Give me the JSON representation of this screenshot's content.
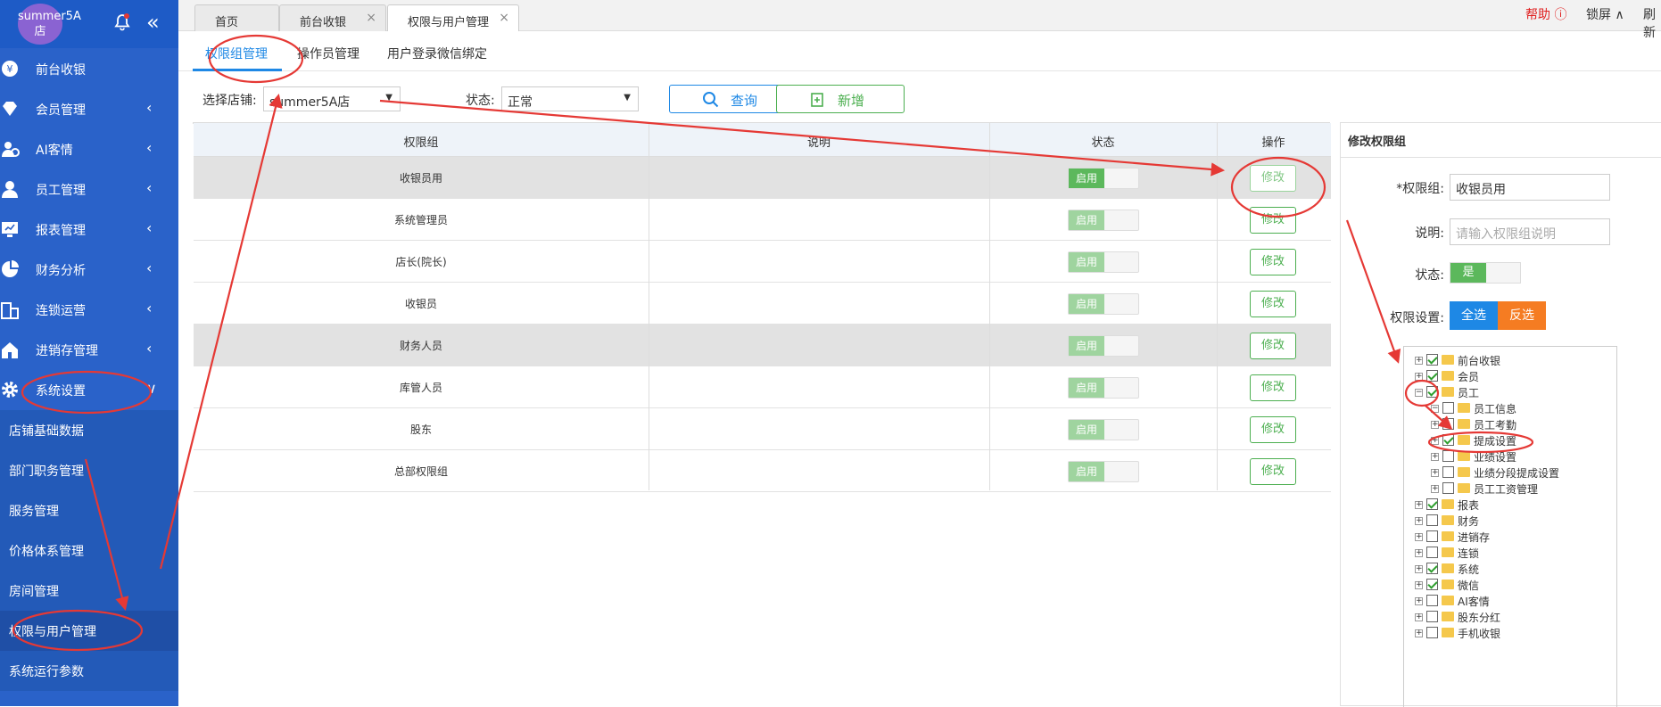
{
  "sidebar": {
    "logo": "summer5A店",
    "menu": [
      {
        "label": "前台收银",
        "icon": "cashier-icon"
      },
      {
        "label": "会员管理",
        "icon": "diamond-icon"
      },
      {
        "label": "AI客情",
        "icon": "ai-customer-icon"
      },
      {
        "label": "员工管理",
        "icon": "user-icon"
      },
      {
        "label": "报表管理",
        "icon": "report-icon"
      },
      {
        "label": "财务分析",
        "icon": "pie-chart-icon"
      },
      {
        "label": "连锁运营",
        "icon": "building-icon"
      },
      {
        "label": "进销存管理",
        "icon": "house-icon"
      },
      {
        "label": "系统设置",
        "icon": "gear-icon"
      }
    ],
    "submenu": [
      "店铺基础数据",
      "部门职务管理",
      "服务管理",
      "价格体系管理",
      "房间管理",
      "权限与用户管理",
      "系统运行参数"
    ]
  },
  "tabs": [
    {
      "label": "首页"
    },
    {
      "label": "前台收银"
    },
    {
      "label": "权限与用户管理"
    }
  ],
  "header": {
    "help": "帮助",
    "lock": "锁屏",
    "refresh": "刷新"
  },
  "subtabs": [
    "权限组管理",
    "操作员管理",
    "用户登录微信绑定"
  ],
  "filters": {
    "store_label": "选择店铺:",
    "store_value": "summer5A店",
    "status_label": "状态:",
    "status_value": "正常",
    "query_label": "查询",
    "add_label": "新增"
  },
  "table": {
    "columns": [
      "权限组",
      "说明",
      "状态",
      "操作"
    ],
    "status_on_label": "启用",
    "edit_label": "修改",
    "rows": [
      {
        "name": "收银员用",
        "desc": ""
      },
      {
        "name": "系统管理员",
        "desc": ""
      },
      {
        "name": "店长(院长)",
        "desc": ""
      },
      {
        "name": "收银员",
        "desc": ""
      },
      {
        "name": "财务人员",
        "desc": ""
      },
      {
        "name": "库管人员",
        "desc": ""
      },
      {
        "name": "股东",
        "desc": ""
      },
      {
        "name": "总部权限组",
        "desc": ""
      }
    ]
  },
  "panel": {
    "title": "修改权限组",
    "group_label": "*权限组:",
    "group_value": "收银员用",
    "desc_label": "说明:",
    "desc_placeholder": "请输入权限组说明",
    "status_label": "状态:",
    "status_value": "是",
    "perm_label": "权限设置:",
    "select_all": "全选",
    "invert": "反选",
    "tree": [
      {
        "label": "前台收银",
        "checked": true,
        "level": 0,
        "expanded": false
      },
      {
        "label": "会员",
        "checked": true,
        "level": 0,
        "expanded": false
      },
      {
        "label": "员工",
        "checked": true,
        "level": 0,
        "expanded": true
      },
      {
        "label": "员工信息",
        "checked": false,
        "level": 1,
        "expanded": true
      },
      {
        "label": "员工考勤",
        "checked": false,
        "level": 1,
        "expanded": false
      },
      {
        "label": "提成设置",
        "checked": true,
        "level": 1,
        "expanded": false
      },
      {
        "label": "业绩设置",
        "checked": false,
        "level": 1,
        "expanded": false
      },
      {
        "label": "业绩分段提成设置",
        "checked": false,
        "level": 1,
        "expanded": false
      },
      {
        "label": "员工工资管理",
        "checked": false,
        "level": 1,
        "expanded": false
      },
      {
        "label": "报表",
        "checked": true,
        "level": 0,
        "expanded": false
      },
      {
        "label": "财务",
        "checked": false,
        "level": 0,
        "expanded": false
      },
      {
        "label": "进销存",
        "checked": false,
        "level": 0,
        "expanded": false
      },
      {
        "label": "连锁",
        "checked": false,
        "level": 0,
        "expanded": false
      },
      {
        "label": "系统",
        "checked": true,
        "level": 0,
        "expanded": false
      },
      {
        "label": "微信",
        "checked": true,
        "level": 0,
        "expanded": false
      },
      {
        "label": "AI客情",
        "checked": false,
        "level": 0,
        "expanded": false
      },
      {
        "label": "股东分红",
        "checked": false,
        "level": 0,
        "expanded": false
      },
      {
        "label": "手机收银",
        "checked": false,
        "level": 0,
        "expanded": false
      }
    ]
  },
  "colors": {
    "sidebar": "#2a62c9",
    "accent": "#1e88e5",
    "green": "#4caf50",
    "orange": "#f57c22",
    "annotation": "#e53935"
  }
}
